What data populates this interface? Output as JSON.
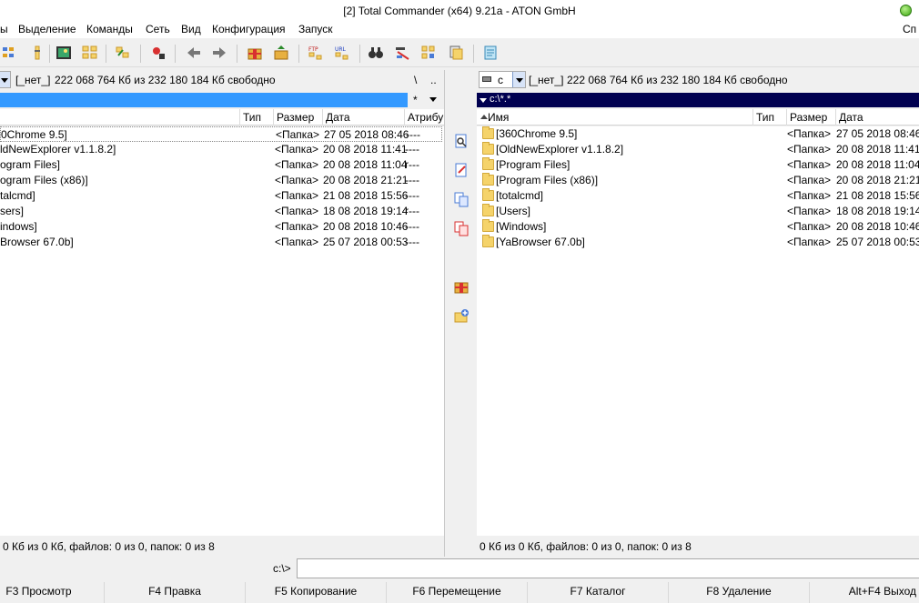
{
  "window": {
    "title": "[2] Total Commander (x64) 9.21a - ATON GmbH"
  },
  "menu": {
    "items": [
      "ы",
      "Выделение",
      "Команды",
      "Сеть",
      "Вид",
      "Конфигурация",
      "Запуск"
    ],
    "right_item": "Сп"
  },
  "toolbar": {
    "icons": [
      "view-mode-icon",
      "tree-icon",
      "thumbnails-icon",
      "compare-icon",
      "sync-icon",
      "unpack-icon",
      "back-icon",
      "forward-icon",
      "pack-icon",
      "unpack-archive-icon",
      "ftp-connect-icon",
      "url-connect-icon",
      "search-icon",
      "multi-rename-icon",
      "sync-dirs-icon",
      "copy-names-icon",
      "notepad-icon"
    ]
  },
  "left_panel": {
    "drive_letter": "",
    "volume_label": "[_нет_]",
    "free_space": "222 068 764 Кб из 232 180 184 Кб свободно",
    "root_button": "\\",
    "up_button": "..",
    "filter_star": "*",
    "columns": {
      "type": "Тип",
      "size": "Размер",
      "date": "Дата",
      "attr": "Атрибу"
    },
    "files": [
      {
        "name": "0Chrome 9.5]",
        "size": "<Папка>",
        "date": "27 05 2018 08:46",
        "attr": "----"
      },
      {
        "name": "ldNewExplorer v1.1.8.2]",
        "size": "<Папка>",
        "date": "20 08 2018 11:41",
        "attr": "----"
      },
      {
        "name": "ogram Files]",
        "size": "<Папка>",
        "date": "20 08 2018 11:04",
        "attr": "r---"
      },
      {
        "name": "ogram Files (x86)]",
        "size": "<Папка>",
        "date": "20 08 2018 21:21",
        "attr": "----"
      },
      {
        "name": "talcmd]",
        "size": "<Папка>",
        "date": "21 08 2018 15:56",
        "attr": "----"
      },
      {
        "name": "sers]",
        "size": "<Папка>",
        "date": "18 08 2018 19:14",
        "attr": "r---"
      },
      {
        "name": "indows]",
        "size": "<Папка>",
        "date": "20 08 2018 10:46",
        "attr": "----"
      },
      {
        "name": "Browser 67.0b]",
        "size": "<Папка>",
        "date": "25 07 2018 00:53",
        "attr": "----"
      }
    ],
    "status": "0 Кб из 0 Кб, файлов: 0 из 0, папок: 0 из 8"
  },
  "right_panel": {
    "drive_letter": "c",
    "volume_label": "[_нет_]",
    "free_space": "222 068 764 Кб из 232 180 184 Кб свободно",
    "path": "c:\\*.*",
    "columns": {
      "name": "Имя",
      "type": "Тип",
      "size": "Размер",
      "date": "Дата"
    },
    "files": [
      {
        "name": "[360Chrome 9.5]",
        "size": "<Папка>",
        "date": "27 05 2018 08:46"
      },
      {
        "name": "[OldNewExplorer v1.1.8.2]",
        "size": "<Папка>",
        "date": "20 08 2018 11:41"
      },
      {
        "name": "[Program Files]",
        "size": "<Папка>",
        "date": "20 08 2018 11:04"
      },
      {
        "name": "[Program Files (x86)]",
        "size": "<Папка>",
        "date": "20 08 2018 21:21"
      },
      {
        "name": "[totalcmd]",
        "size": "<Папка>",
        "date": "21 08 2018 15:56"
      },
      {
        "name": "[Users]",
        "size": "<Папка>",
        "date": "18 08 2018 19:14"
      },
      {
        "name": "[Windows]",
        "size": "<Папка>",
        "date": "20 08 2018 10:46"
      },
      {
        "name": "[YaBrowser 67.0b]",
        "size": "<Папка>",
        "date": "25 07 2018 00:53"
      }
    ],
    "status": "0 Кб из 0 Кб, файлов: 0 из 0, папок: 0 из 8"
  },
  "command_line": {
    "prompt": "c:\\>"
  },
  "function_keys": [
    "F3 Просмотр",
    "F4 Правка",
    "F5 Копирование",
    "F6 Перемещение",
    "F7 Каталог",
    "F8 Удаление",
    "Alt+F4 Выход"
  ],
  "colors": {
    "left_path_active": "#3399ff",
    "right_path_inactive": "#000050",
    "folder_fill": "#f5d36a"
  }
}
